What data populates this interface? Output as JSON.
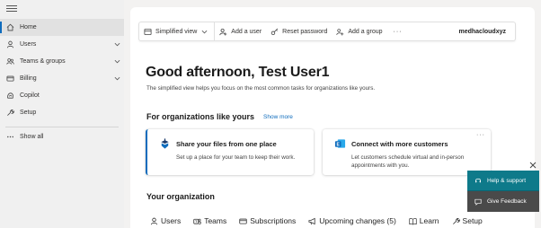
{
  "sidebar": {
    "items": [
      {
        "label": "Home",
        "icon": "home-icon",
        "has_chevron": false,
        "active": true
      },
      {
        "label": "Users",
        "icon": "user-icon",
        "has_chevron": true
      },
      {
        "label": "Teams & groups",
        "icon": "teams-icon",
        "has_chevron": true
      },
      {
        "label": "Billing",
        "icon": "billing-icon",
        "has_chevron": true
      },
      {
        "label": "Copilot",
        "icon": "copilot-icon",
        "has_chevron": false
      },
      {
        "label": "Setup",
        "icon": "wrench-icon",
        "has_chevron": false
      }
    ],
    "show_all": "Show all"
  },
  "toolbar": {
    "view_select": "Simplified view",
    "add_user": "Add a user",
    "reset_password": "Reset password",
    "add_group": "Add a group",
    "more": "···",
    "domain": "medhacloudxyz"
  },
  "main": {
    "greeting": "Good afternoon, Test User1",
    "subtext": "The simplified view helps you focus on the most common tasks for organizations like yours.",
    "section_title": "For organizations like yours",
    "show_more": "Show more",
    "tiles": [
      {
        "title": "Share your files from one place",
        "desc": "Set up a place for your team to keep their work.",
        "icon": "onedrive-icon"
      },
      {
        "title": "Connect with more customers",
        "desc": "Let customers schedule virtual and in-person appointments with you.",
        "icon": "exchange-icon",
        "more": "···"
      }
    ],
    "org_title": "Your organization",
    "tabs": [
      {
        "label": "Users",
        "icon": "user-icon",
        "active": true
      },
      {
        "label": "Teams",
        "icon": "teams-icon"
      },
      {
        "label": "Subscriptions",
        "icon": "card-icon"
      },
      {
        "label": "Upcoming changes (5)",
        "icon": "megaphone-icon"
      },
      {
        "label": "Learn",
        "icon": "book-icon"
      },
      {
        "label": "Setup",
        "icon": "wrench-icon"
      }
    ]
  },
  "help": {
    "support_label": "Help & support",
    "feedback_label": "Give Feedback"
  },
  "colors": {
    "accent": "#0f6cbd",
    "help_support_bg": "#0e7a8a",
    "help_feedback_bg": "#4a4a4a",
    "sidebar_bg": "#f0f0f0"
  }
}
